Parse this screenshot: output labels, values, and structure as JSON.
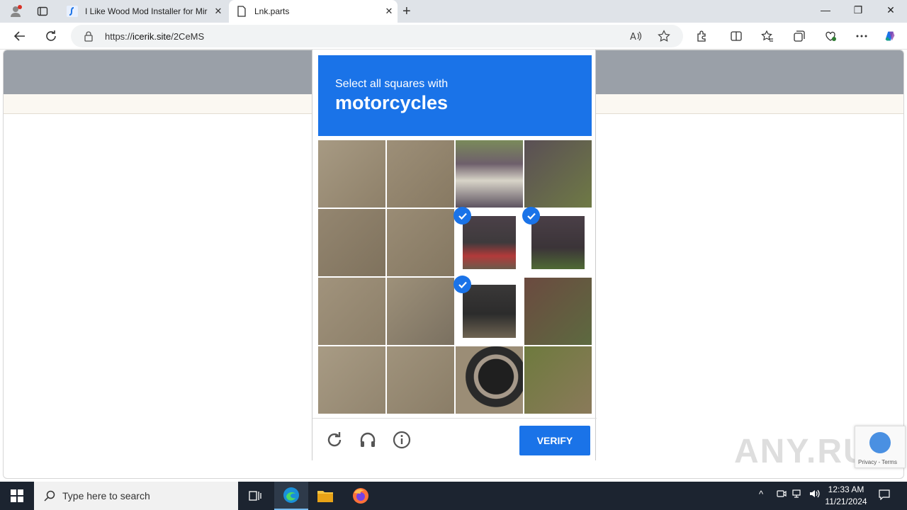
{
  "browser": {
    "tabs": [
      {
        "title": "I Like Wood Mod Installer for Mir",
        "active": false
      },
      {
        "title": "Lnk.parts",
        "active": true
      }
    ],
    "url_host": "icerik.site",
    "url_prefix": "https://",
    "url_path": "/2CeMS"
  },
  "captcha": {
    "instruction": "Select all squares with",
    "target": "motorcycles",
    "grid_size": 4,
    "selected_cells": [
      6,
      7,
      10
    ],
    "verify_label": "VERIFY",
    "colors": {
      "accent": "#1a73e8"
    }
  },
  "watermark": "ANY.RUN",
  "recaptcha_badge": {
    "terms": "Privacy - Terms"
  },
  "taskbar": {
    "search_placeholder": "Type here to search",
    "time": "12:33 AM",
    "date": "11/21/2024"
  }
}
